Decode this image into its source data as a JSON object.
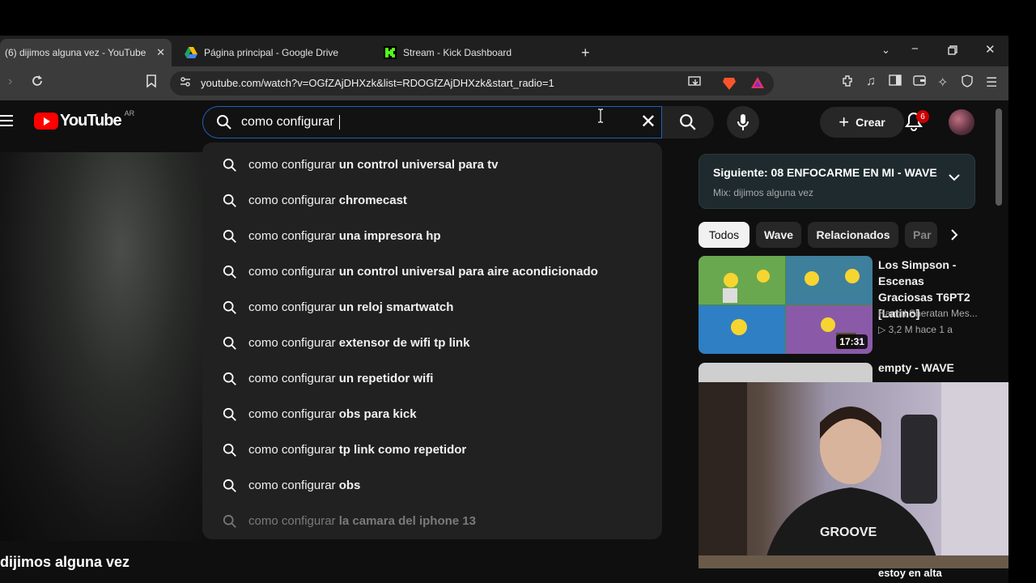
{
  "browser": {
    "tabs": [
      {
        "title": "(6) dijimos alguna vez - YouTube",
        "close": "✕",
        "active": true
      },
      {
        "title": "Página principal - Google Drive",
        "active": false
      },
      {
        "title": "Stream - Kick Dashboard",
        "active": false
      }
    ],
    "new_tab": "+",
    "url": "youtube.com/watch?v=OGfZAjDHXzk&list=RDOGfZAjDHXzk&start_radio=1"
  },
  "youtube": {
    "logo_text": "YouTube",
    "country": "AR",
    "search": {
      "query": "como configurar ",
      "clear": "✕"
    },
    "create_label": "Crear",
    "create_plus": "+",
    "notifications": "6",
    "suggestions": [
      {
        "prefix": "como configurar ",
        "rest": "un control universal para tv"
      },
      {
        "prefix": "como configurar ",
        "rest": "chromecast"
      },
      {
        "prefix": "como configurar ",
        "rest": "una impresora hp"
      },
      {
        "prefix": "como configurar ",
        "rest": "un control universal para aire acondicionado"
      },
      {
        "prefix": "como configurar ",
        "rest": "un reloj smartwatch"
      },
      {
        "prefix": "como configurar ",
        "rest": "extensor de wifi tp link"
      },
      {
        "prefix": "como configurar ",
        "rest": "un repetidor wifi"
      },
      {
        "prefix": "como configurar ",
        "rest": "obs para kick"
      },
      {
        "prefix": "como configurar ",
        "rest": "tp link como repetidor"
      },
      {
        "prefix": "como configurar ",
        "rest": "obs"
      },
      {
        "prefix": "como configurar ",
        "rest": "la camara del iphone 13"
      }
    ],
    "up_next": {
      "title": "Siguiente: 08 ENFOCARME EN MI - WAVE",
      "subtitle": "Mix: dijimos alguna vez"
    },
    "chips": [
      "Todos",
      "Wave",
      "Relacionados",
      "Par"
    ],
    "videos": [
      {
        "title": "Los Simpson - Escenas Graciosas T6PT2 [Latino]",
        "channel": "Hamal Sheratan Mes...",
        "meta": "3,2 M  hace 1 a",
        "duration": "17:31"
      },
      {
        "title": "empty - WAVE"
      }
    ],
    "playing_title": "dijimos alguna vez",
    "bottom_item": "estoy en alta"
  }
}
